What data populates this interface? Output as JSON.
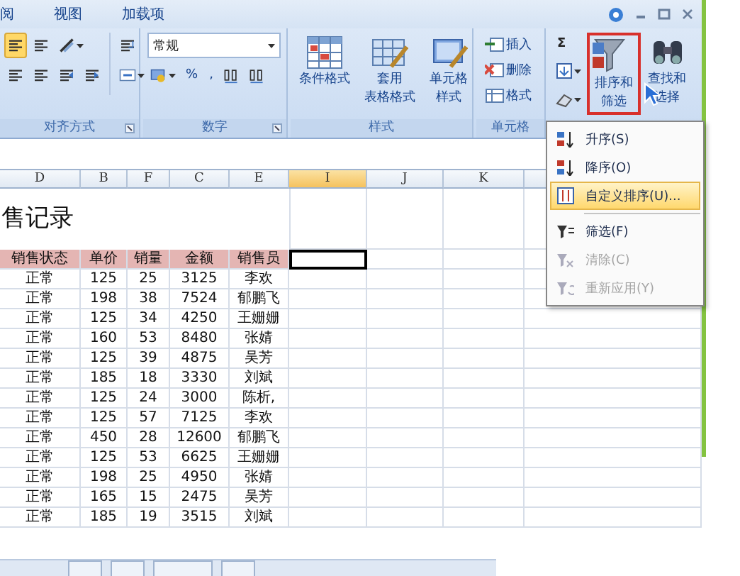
{
  "tabs": [
    {
      "label": "阅"
    },
    {
      "label": "视图"
    },
    {
      "label": "加载项"
    }
  ],
  "ribbon": {
    "alignment": {
      "label": "对齐方式",
      "toggles": [
        {
          "on": true
        },
        {
          "on": false
        }
      ]
    },
    "number": {
      "label": "数字",
      "format": "常规",
      "percent": "%",
      "comma": ","
    },
    "styles": {
      "label": "样式",
      "buttons": [
        [
          "条件格式"
        ],
        [
          "套用",
          "表格格式"
        ],
        [
          "单元格",
          "样式"
        ]
      ]
    },
    "cells": {
      "label": "单元格",
      "buttons": [
        "插入",
        "删除",
        "格式"
      ]
    },
    "editing": {
      "sum": "Σ",
      "sort": {
        "label": [
          "排序和",
          "筛选"
        ],
        "highlighted": true
      },
      "find": [
        "查找和",
        "选择"
      ]
    }
  },
  "sheet": {
    "columns": [
      {
        "label": "D",
        "selected": false
      },
      {
        "label": "B",
        "selected": false
      },
      {
        "label": "F",
        "selected": false
      },
      {
        "label": "C",
        "selected": false
      },
      {
        "label": "E",
        "selected": false
      },
      {
        "label": "I",
        "selected": true
      },
      {
        "label": "J",
        "selected": false
      },
      {
        "label": "K",
        "selected": false
      }
    ],
    "title": "售记录",
    "header": [
      "销售状态",
      "单价",
      "销量",
      "金额",
      "销售员"
    ],
    "active_cell_in_header_row": true,
    "rows": [
      [
        "正常",
        "125",
        "25",
        "3125",
        "李欢"
      ],
      [
        "正常",
        "198",
        "38",
        "7524",
        "郁鹏飞"
      ],
      [
        "正常",
        "125",
        "34",
        "4250",
        "王姗姗"
      ],
      [
        "正常",
        "160",
        "53",
        "8480",
        "张婧"
      ],
      [
        "正常",
        "125",
        "39",
        "4875",
        "吴芳"
      ],
      [
        "正常",
        "185",
        "18",
        "3330",
        "刘斌"
      ],
      [
        "正常",
        "125",
        "24",
        "3000",
        "陈析,"
      ],
      [
        "正常",
        "125",
        "57",
        "7125",
        "李欢"
      ],
      [
        "正常",
        "450",
        "28",
        "12600",
        "郁鹏飞"
      ],
      [
        "正常",
        "125",
        "53",
        "6625",
        "王姗姗"
      ],
      [
        "正常",
        "198",
        "25",
        "4950",
        "张婧"
      ],
      [
        "正常",
        "165",
        "15",
        "2475",
        "吴芳"
      ],
      [
        "正常",
        "185",
        "19",
        "3515",
        "刘斌"
      ]
    ]
  },
  "menu": {
    "groups": [
      [
        {
          "kind": "asc",
          "label": "升序(S)",
          "selected": false,
          "disabled": false
        },
        {
          "kind": "desc",
          "label": "降序(O)",
          "selected": false,
          "disabled": false
        },
        {
          "kind": "custom",
          "label": "自定义排序(U)...",
          "selected": true,
          "disabled": false
        }
      ],
      [
        {
          "kind": "filter",
          "label": "筛选(F)",
          "selected": false,
          "disabled": false
        },
        {
          "kind": "clear",
          "label": "清除(C)",
          "selected": false,
          "disabled": true
        },
        {
          "kind": "reapply",
          "label": "重新应用(Y)",
          "selected": false,
          "disabled": true
        }
      ]
    ]
  }
}
